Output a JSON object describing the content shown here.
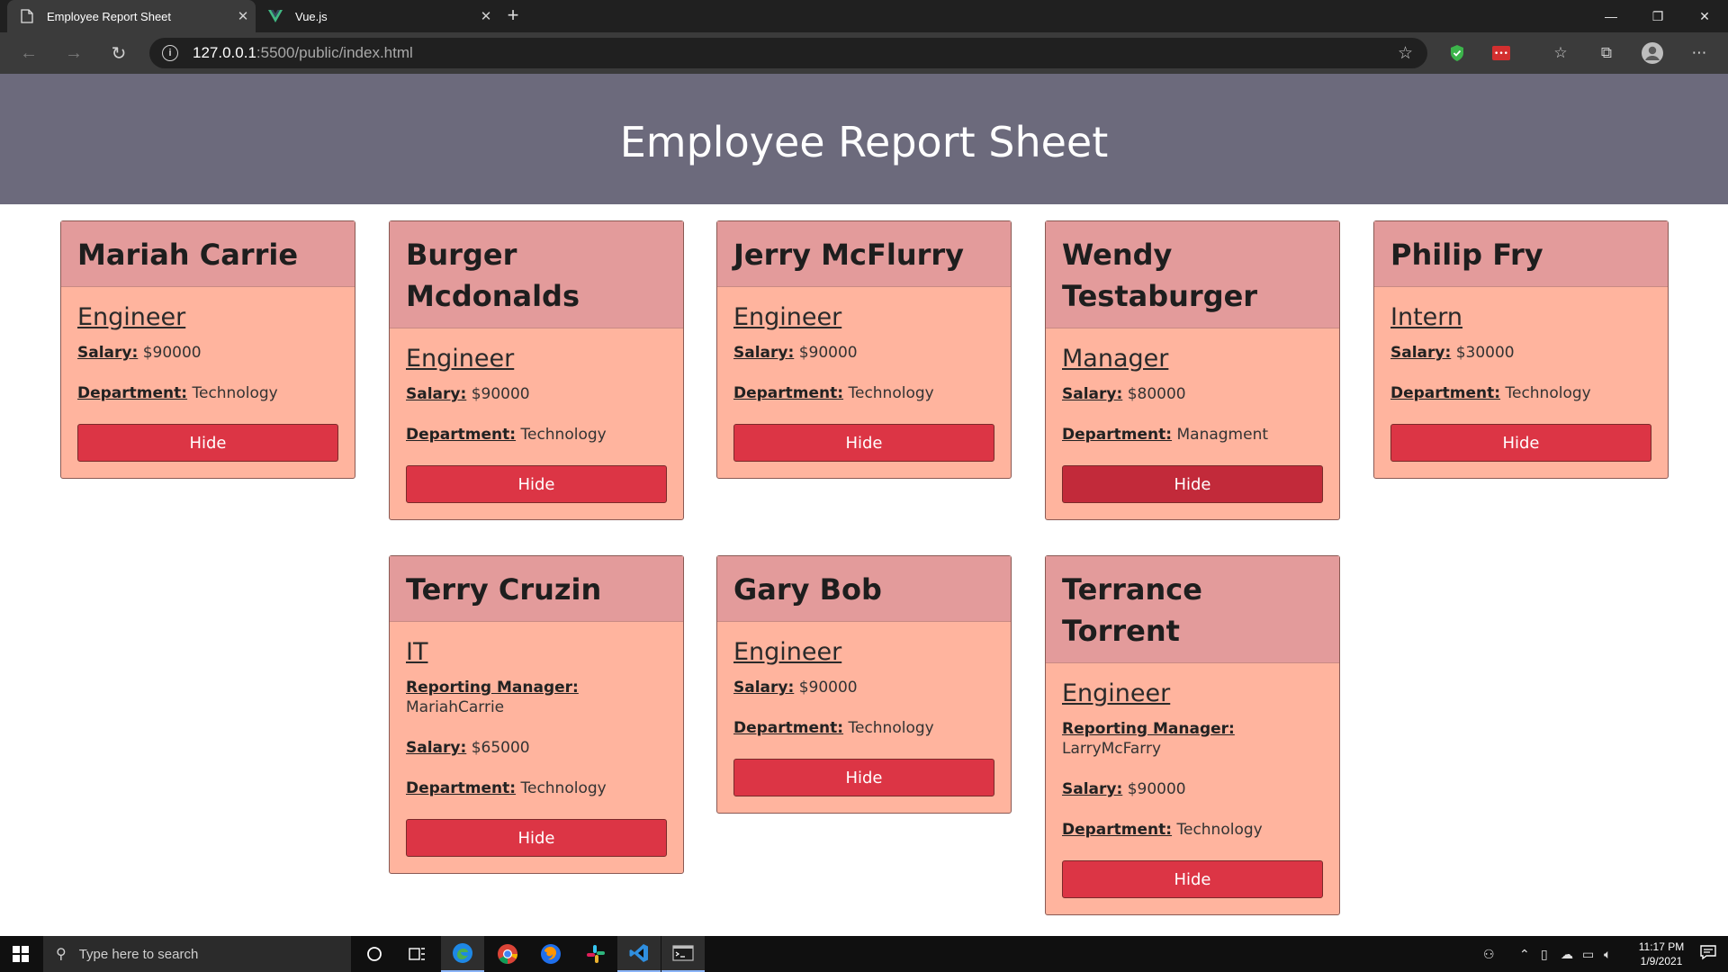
{
  "browser": {
    "tabs": [
      {
        "title": "Employee Report Sheet",
        "icon": "page-icon",
        "active": true
      },
      {
        "title": "Vue.js",
        "icon": "vue-logo-icon",
        "active": false
      }
    ],
    "url_host": "127.0.0.1",
    "url_path": ":5500/public/index.html"
  },
  "page": {
    "title": "Employee Report Sheet"
  },
  "labels": {
    "salary": "Salary:",
    "department": "Department:",
    "reporting_manager": "Reporting Manager:",
    "hide": "Hide"
  },
  "employees": [
    {
      "name": "Mariah Carrie",
      "role": "Engineer",
      "salary": "$90000",
      "department": "Technology"
    },
    {
      "name": "Burger Mcdonalds",
      "role": "Engineer",
      "salary": "$90000",
      "department": "Technology"
    },
    {
      "name": "Jerry McFlurry",
      "role": "Engineer",
      "salary": "$90000",
      "department": "Technology"
    },
    {
      "name": "Wendy Testaburger",
      "role": "Manager",
      "salary": "$80000",
      "department": "Managment"
    },
    {
      "name": "Philip Fry",
      "role": "Intern",
      "salary": "$30000",
      "department": "Technology"
    },
    {
      "name": "Terry Cruzin",
      "role": "IT",
      "reporting_manager": "MariahCarrie",
      "salary": "$65000",
      "department": "Technology"
    },
    {
      "name": "Gary Bob",
      "role": "Engineer",
      "salary": "$90000",
      "department": "Technology"
    },
    {
      "name": "Terrance Torrent",
      "role": "Engineer",
      "reporting_manager": "LarryMcFarry",
      "salary": "$90000",
      "department": "Technology"
    }
  ],
  "taskbar": {
    "search_placeholder": "Type here to search",
    "time": "11:17 PM",
    "date": "1/9/2021"
  },
  "colors": {
    "header_bg": "#6c6a7c",
    "card_bg": "#ffb49e",
    "card_head_bg": "#e39b9b",
    "button_bg": "#dc3545"
  }
}
